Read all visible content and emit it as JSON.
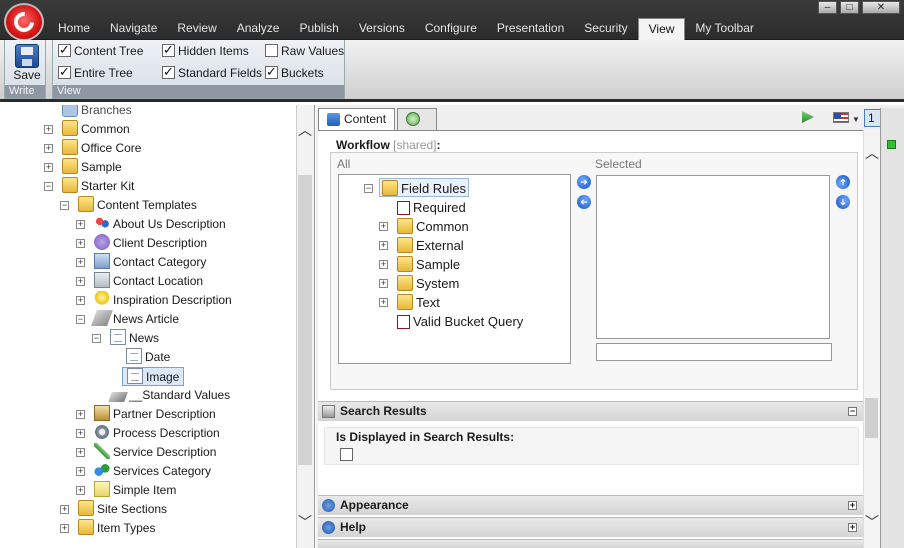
{
  "menu_tabs": [
    "Home",
    "Navigate",
    "Review",
    "Analyze",
    "Publish",
    "Versions",
    "Configure",
    "Presentation",
    "Security",
    "View",
    "My Toolbar"
  ],
  "active_tab": "View",
  "window_controls": [
    "–",
    "□",
    "✕"
  ],
  "ribbon": {
    "write_group": {
      "save_label": "Save",
      "group_label": "Write"
    },
    "view_group": {
      "group_label": "View",
      "checks": [
        {
          "label": "Content Tree",
          "checked": true
        },
        {
          "label": "Entire Tree",
          "checked": true
        },
        {
          "label": "Hidden Items",
          "checked": true
        },
        {
          "label": "Standard Fields",
          "checked": true
        },
        {
          "label": "Raw Values",
          "checked": false
        },
        {
          "label": "Buckets",
          "checked": true
        }
      ]
    }
  },
  "tree": {
    "items": [
      {
        "label": "Branches",
        "icon": "branches-icon"
      },
      {
        "label": "Common",
        "icon": "folder-icon"
      },
      {
        "label": "Office Core",
        "icon": "folder-icon"
      },
      {
        "label": "Sample",
        "icon": "folder-icon"
      },
      {
        "label": "Starter Kit",
        "icon": "folder-icon"
      },
      {
        "label": "Content Templates",
        "icon": "folder-icon"
      },
      {
        "label": "About Us Description",
        "icon": "people-icon"
      },
      {
        "label": "Client Description",
        "icon": "client-icon"
      },
      {
        "label": "Contact Category",
        "icon": "contact-icon"
      },
      {
        "label": "Contact Location",
        "icon": "location-icon"
      },
      {
        "label": "Inspiration Description",
        "icon": "lightbulb-icon"
      },
      {
        "label": "News Article",
        "icon": "news-icon"
      },
      {
        "label": "News",
        "icon": "document-icon"
      },
      {
        "label": "Date",
        "icon": "document-icon"
      },
      {
        "label": "Image",
        "icon": "document-icon"
      },
      {
        "label": "__Standard Values",
        "icon": "standard-values-icon"
      },
      {
        "label": "Partner Description",
        "icon": "partner-icon"
      },
      {
        "label": "Process Description",
        "icon": "gears-icon"
      },
      {
        "label": "Service Description",
        "icon": "pen-icon"
      },
      {
        "label": "Services Category",
        "icon": "users-icon"
      },
      {
        "label": "Simple Item",
        "icon": "note-icon"
      },
      {
        "label": "Site Sections",
        "icon": "folder-icon"
      },
      {
        "label": "Item Types",
        "icon": "folder-icon"
      }
    ]
  },
  "editor": {
    "tabs": [
      {
        "label": "Content"
      }
    ],
    "language_count": "1",
    "workflow_label": "Workflow",
    "workflow_shared": "[shared]",
    "workflow_colon": ":",
    "all_label": "All",
    "selected_label": "Selected",
    "field_tree": [
      {
        "label": "Field Rules",
        "type": "folder"
      },
      {
        "label": "Required",
        "type": "rule"
      },
      {
        "label": "Common",
        "type": "folder"
      },
      {
        "label": "External",
        "type": "folder"
      },
      {
        "label": "Sample",
        "type": "folder"
      },
      {
        "label": "System",
        "type": "folder"
      },
      {
        "label": "Text",
        "type": "folder"
      },
      {
        "label": "Valid Bucket Query",
        "type": "rule"
      }
    ],
    "sections": [
      {
        "title": "Search Results",
        "collapse_glyph": "−"
      },
      {
        "title": "Appearance",
        "collapse_glyph": "+"
      },
      {
        "title": "Help",
        "collapse_glyph": "+"
      }
    ],
    "search_results_field": "Is Displayed in Search Results:"
  },
  "colors": {
    "accent": "#2f6fd0",
    "topbar": "#333333",
    "ribbon_label": "#8e97a3"
  }
}
